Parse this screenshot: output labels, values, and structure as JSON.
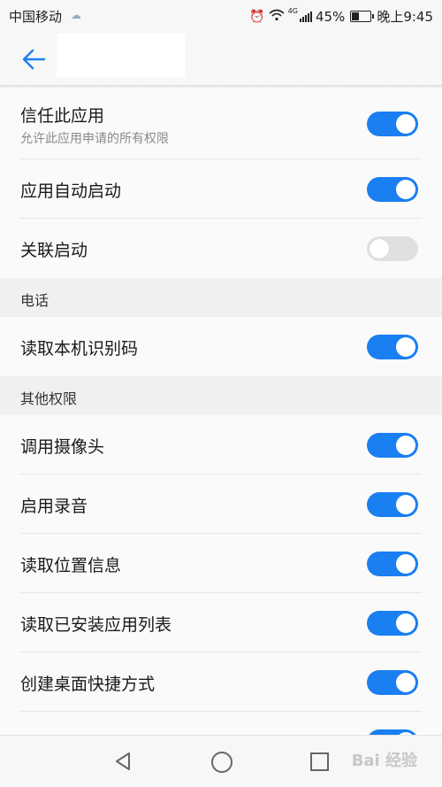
{
  "status": {
    "carrier": "中国移动",
    "network": "4G",
    "battery": "45%",
    "battery_level": 0.45,
    "time": "晚上9:45"
  },
  "appbar": {
    "back_icon": "arrow-left-icon"
  },
  "rows": [
    {
      "label": "信任此应用",
      "sub": "允许此应用申请的所有权限",
      "on": true
    },
    {
      "label": "应用自动启动",
      "on": true
    },
    {
      "label": "关联启动",
      "on": false
    }
  ],
  "section_phone": {
    "title": "电话",
    "rows": [
      {
        "label": "读取本机识别码",
        "on": true
      }
    ]
  },
  "section_other": {
    "title": "其他权限",
    "rows": [
      {
        "label": "调用摄像头",
        "on": true
      },
      {
        "label": "启用录音",
        "on": true
      },
      {
        "label": "读取位置信息",
        "on": true
      },
      {
        "label": "读取已安装应用列表",
        "on": true
      },
      {
        "label": "创建桌面快捷方式",
        "on": true
      }
    ]
  },
  "navbar": {
    "watermark": "Bai 经验"
  },
  "colors": {
    "accent": "#1a7ff0",
    "toggle_off": "#e0e0e0"
  }
}
